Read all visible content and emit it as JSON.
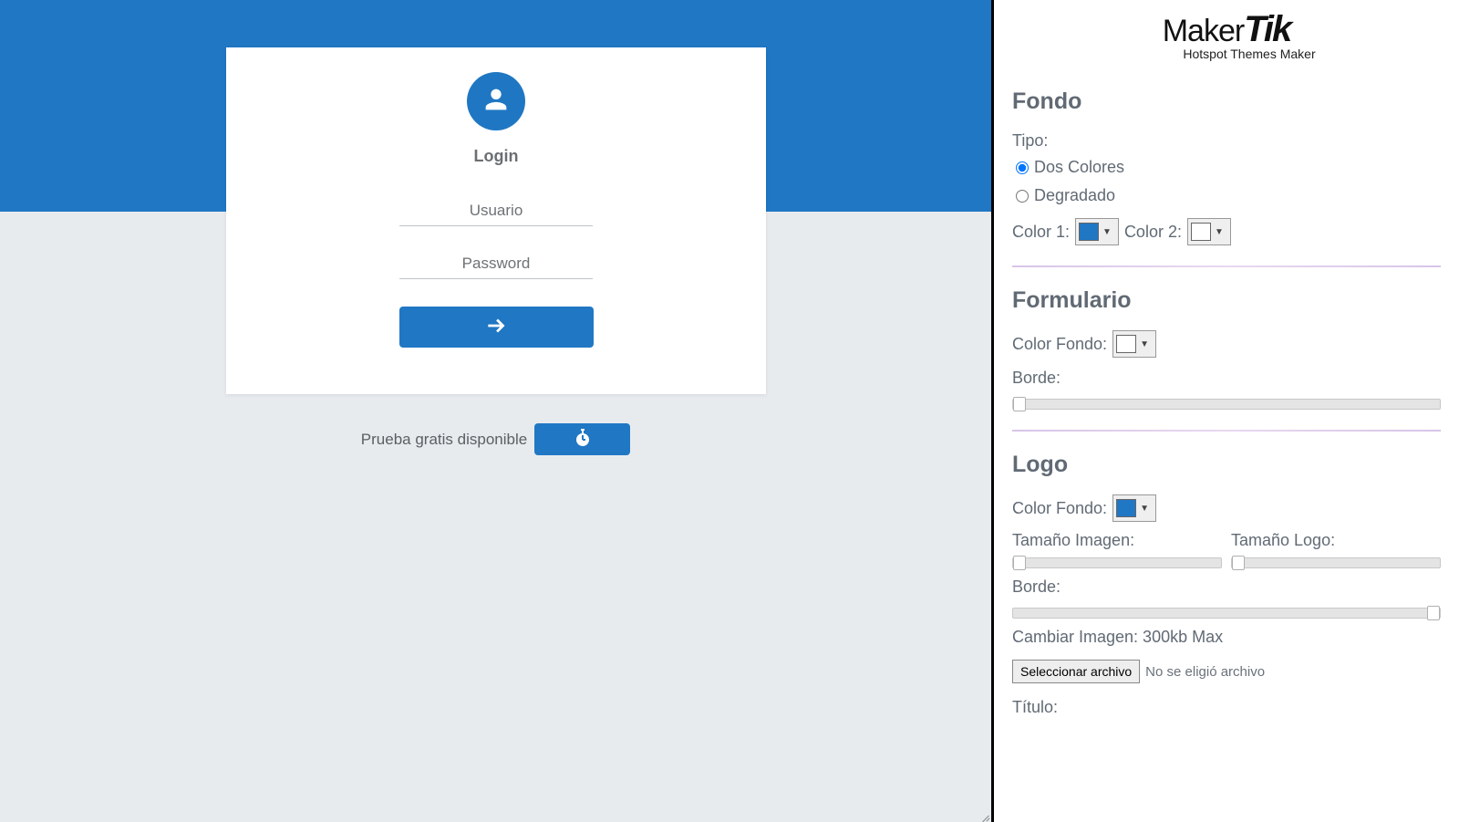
{
  "brand": {
    "name_part1": "Maker",
    "name_part2": "Tik",
    "tagline": "Hotspot Themes Maker"
  },
  "preview": {
    "login_title": "Login",
    "username_placeholder": "Usuario",
    "password_placeholder": "Password",
    "trial_text": "Prueba gratis disponible"
  },
  "sidebar": {
    "fondo": {
      "heading": "Fondo",
      "tipo_label": "Tipo:",
      "option_dos_colores": "Dos Colores",
      "option_degradado": "Degradado",
      "color1_label": "Color 1:",
      "color2_label": "Color 2:",
      "color1_value": "#2077c4",
      "color2_value": "#ffffff"
    },
    "formulario": {
      "heading": "Formulario",
      "color_fondo_label": "Color Fondo:",
      "color_fondo_value": "#ffffff",
      "borde_label": "Borde:"
    },
    "logo": {
      "heading": "Logo",
      "color_fondo_label": "Color Fondo:",
      "color_fondo_value": "#2077c4",
      "tamano_imagen_label": "Tamaño Imagen:",
      "tamano_logo_label": "Tamaño Logo:",
      "borde_label": "Borde:",
      "cambiar_imagen_label": "Cambiar Imagen: 300kb Max",
      "file_button": "Seleccionar archivo",
      "file_status": "No se eligió archivo",
      "titulo_label": "Título:"
    }
  }
}
